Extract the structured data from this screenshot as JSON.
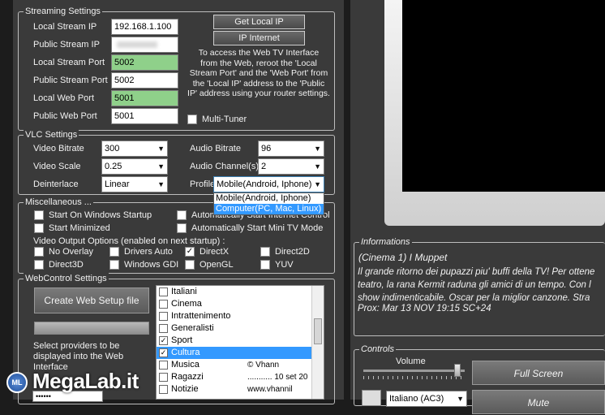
{
  "streaming": {
    "title": "Streaming Settings",
    "local_stream_ip_label": "Local Stream IP",
    "local_stream_ip": "192.168.1.100",
    "public_stream_ip_label": "Public Stream IP",
    "public_stream_ip": "",
    "local_stream_port_label": "Local Stream Port",
    "local_stream_port": "5002",
    "public_stream_port_label": "Public Stream Port",
    "public_stream_port": "5002",
    "local_web_port_label": "Local Web Port",
    "local_web_port": "5001",
    "public_web_port_label": "Public Web Port",
    "public_web_port": "5001",
    "get_local_ip": "Get Local IP",
    "ip_internet": "IP Internet",
    "help_lines": [
      "To access the Web TV Interface",
      "from the Web, reroot the 'Local",
      "Stream Port' and the 'Web Port' from",
      "the 'Local IP' address to the 'Public",
      "IP' address using your router settings."
    ],
    "multi_tuner": "Multi-Tuner"
  },
  "vlc": {
    "title": "VLC Settings",
    "video_bitrate_label": "Video Bitrate",
    "video_bitrate": "300",
    "video_scale_label": "Video Scale",
    "video_scale": "0.25",
    "deinterlace_label": "Deinterlace",
    "deinterlace": "Linear",
    "audio_bitrate_label": "Audio Bitrate",
    "audio_bitrate": "96",
    "audio_channels_label": "Audio Channel(s)",
    "audio_channels": "2",
    "profile_label": "Profile",
    "profile": "Mobile(Android, Iphone)",
    "profile_options": [
      "Mobile(Android, Iphone)",
      "Computer(PC, Mac, Linux)"
    ]
  },
  "misc": {
    "title": "Miscellaneous ...",
    "start_windows": "Start On Windows Startup",
    "start_minimized": "Start Minimized",
    "auto_internet": "Automatically Start Internet Control",
    "auto_mini": "Automatically Start Mini TV Mode",
    "video_output_label": "Video Output Options (enabled on next startup) :",
    "no_overlay": "No Overlay",
    "drivers_auto": "Drivers Auto",
    "directx": "DirectX",
    "direct2d": "Direct2D",
    "direct3d": "Direct3D",
    "windows_gdi": "Windows GDI",
    "opengl": "OpenGL",
    "yuv": "YUV",
    "check_mark": "✓"
  },
  "webcontrol": {
    "title": "WebControl Settings",
    "create_button": "Create Web Setup file",
    "providers_lines": [
      "Select providers to be",
      "displayed into the Web",
      "Interface"
    ],
    "password": "••••••",
    "categories": [
      "Italiani",
      "Cinema",
      "Intrattenimento",
      "Generalisti",
      "Sport",
      "Cultura",
      "Musica",
      "Ragazzi",
      "Notizie"
    ],
    "cat_extra": [
      "",
      "",
      "",
      "",
      "",
      "",
      "© Vhann",
      "........... 10 set 20",
      "www.vhannil"
    ]
  },
  "info": {
    "title": "Informations",
    "program": "(Cinema 1) I Muppet",
    "desc_lines": [
      "Il grande ritorno dei pupazzi piu' buffi della TV! Per ottene",
      "teatro, la rana Kermit raduna gli amici di un tempo. Con l",
      "show indimenticabile. Oscar per la miglior canzone. Stra"
    ],
    "prox": "Prox: Mar 13 NOV 19:15 SC+24"
  },
  "controls": {
    "title": "Controls",
    "volume_label": "Volume",
    "volume_level": 0.93,
    "full_screen": "Full Screen",
    "second_button": "Mute",
    "bottom_select": "Italiano (AC3)"
  },
  "watermark": "MegaLab.it"
}
